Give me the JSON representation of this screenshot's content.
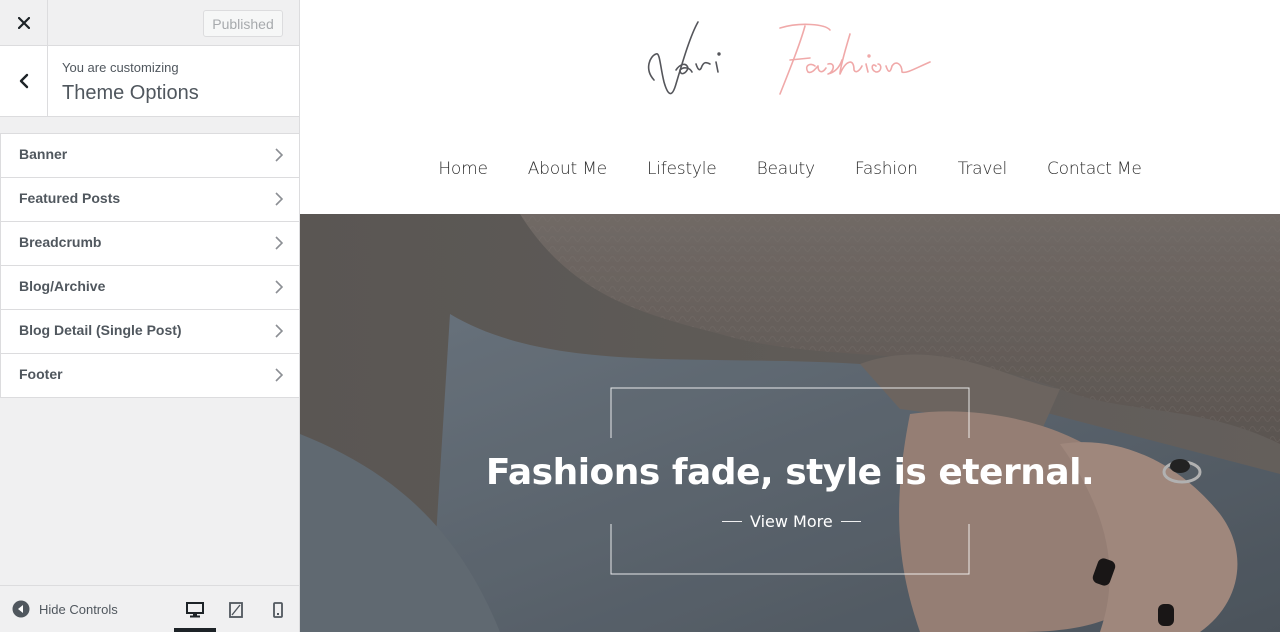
{
  "customizer": {
    "publish_label": "Published",
    "customizing_label": "You are customizing",
    "section_title": "Theme Options",
    "items": [
      {
        "label": "Banner"
      },
      {
        "label": "Featured Posts"
      },
      {
        "label": "Breadcrumb"
      },
      {
        "label": "Blog/Archive"
      },
      {
        "label": "Blog Detail (Single Post)"
      },
      {
        "label": "Footer"
      }
    ],
    "hide_controls_label": "Hide Controls",
    "devices": [
      "desktop-icon",
      "tablet-icon",
      "mobile-icon"
    ],
    "active_device": "desktop"
  },
  "site": {
    "logo_text_1": "Nari",
    "logo_text_2": "Fashion",
    "nav": [
      "Home",
      "About Me",
      "Lifestyle",
      "Beauty",
      "Fashion",
      "Travel",
      "Contact Me"
    ],
    "hero": {
      "heading": "Fashions fade, style is eternal.",
      "button_label": "View More"
    }
  },
  "colors": {
    "logo_dark": "#55565b",
    "logo_pink": "#f0a9a9",
    "admin_text": "#50575e"
  }
}
